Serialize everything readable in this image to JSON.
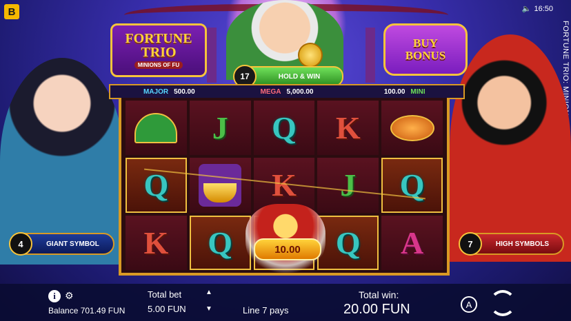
{
  "system": {
    "brand_letter": "B",
    "time": "16:50",
    "vertical_title": "FORTUNE TRIO: MINIONS OF FU"
  },
  "logo": {
    "line1": "FORTUNE",
    "line2": "TRIO",
    "subtitle": "MINIONS OF FU"
  },
  "buy_bonus": {
    "line1": "BUY",
    "line2": "BONUS"
  },
  "hold_win": {
    "count": "17",
    "label": "HOLD & WIN"
  },
  "jackpots": [
    {
      "name": "MAJOR",
      "value": "500.00"
    },
    {
      "name": "MEGA",
      "value": "5,000.00"
    },
    {
      "name": "MINI",
      "value": "100.00"
    }
  ],
  "reels": [
    [
      "fan-symbol",
      "J",
      "Q",
      "K",
      "koi-symbol"
    ],
    [
      "Q",
      "ingot-symbol",
      "K",
      "J",
      "Q"
    ],
    [
      "K",
      "Q",
      "bonus-coin",
      "Q",
      "A"
    ]
  ],
  "bonus_coin_value": "10.00",
  "left_badge": {
    "count": "4",
    "label": "GIANT SYMBOL"
  },
  "right_badge": {
    "count": "7",
    "label": "HIGH SYMBOLS"
  },
  "bottom": {
    "balance": "Balance 701.49 FUN",
    "total_bet_label": "Total bet",
    "total_bet_value": "5.00 FUN",
    "line_pays": "Line 7 pays",
    "total_win_label": "Total win:",
    "total_win_value": "20.00 FUN",
    "auto_label": "A"
  },
  "colors": {
    "accent_gold": "#f7c43b",
    "bg_purple": "#3a2fb0",
    "reel_bg": "#3a0a14"
  }
}
